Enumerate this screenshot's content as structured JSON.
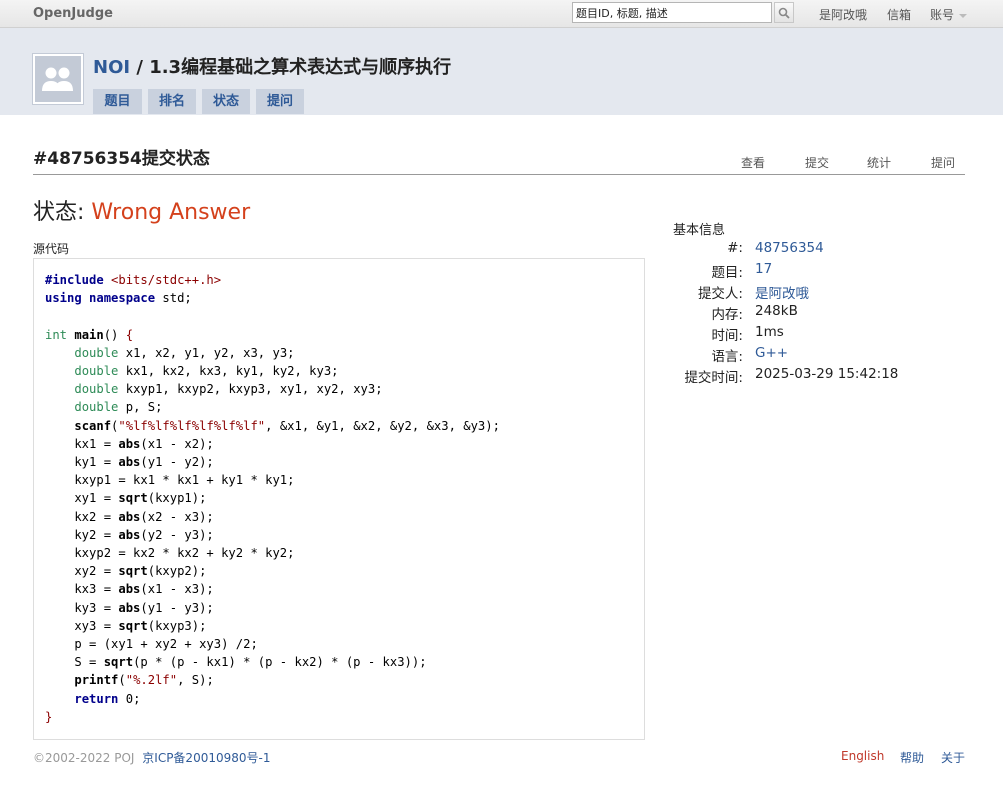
{
  "topbar": {
    "brand": "OpenJudge",
    "search_value": "题目ID, 标题, 描述",
    "user": "是阿改哦",
    "mailbox": "信箱",
    "account": "账号"
  },
  "header": {
    "group": "NOI",
    "separator": " / ",
    "course": "1.3编程基础之算术表达式与顺序执行",
    "tabs": [
      "题目",
      "排名",
      "状态",
      "提问"
    ]
  },
  "page": {
    "title": "#48756354提交状态",
    "subnav": [
      "查看",
      "提交",
      "统计",
      "提问"
    ],
    "status_label": "状态: ",
    "status_value": "Wrong Answer",
    "source_label": "源代码"
  },
  "code": [
    "#include <bits/stdc++.h>",
    "using namespace std;",
    "",
    "int main() {",
    "    double x1, x2, y1, y2, x3, y3;",
    "    double kx1, kx2, kx3, ky1, ky2, ky3;",
    "    double kxyp1, kxyp2, kxyp3, xy1, xy2, xy3;",
    "    double p, S;",
    "    scanf(\"%lf%lf%lf%lf%lf%lf\", &x1, &y1, &x2, &y2, &x3, &y3);",
    "    kx1 = abs(x1 - x2);",
    "    ky1 = abs(y1 - y2);",
    "    kxyp1 = kx1 * kx1 + ky1 * ky1;",
    "    xy1 = sqrt(kxyp1);",
    "    kx2 = abs(x2 - x3);",
    "    ky2 = abs(y2 - y3);",
    "    kxyp2 = kx2 * kx2 + ky2 * ky2;",
    "    xy2 = sqrt(kxyp2);",
    "    kx3 = abs(x1 - x3);",
    "    ky3 = abs(y1 - y3);",
    "    xy3 = sqrt(kxyp3);",
    "    p = (xy1 + xy2 + xy3) /2;",
    "    S = sqrt(p * (p - kx1) * (p - kx2) * (p - kx3));",
    "    printf(\"%.2lf\", S);",
    "    return 0;",
    "}"
  ],
  "info": {
    "title": "基本信息",
    "rows": [
      {
        "key": "#:",
        "value": "48756354",
        "link": true
      },
      {
        "key": "题目:",
        "value": "17",
        "link": true
      },
      {
        "key": "提交人:",
        "value": "是阿改哦",
        "link": true
      },
      {
        "key": "内存:",
        "value": "248kB",
        "link": false
      },
      {
        "key": "时间:",
        "value": "1ms",
        "link": false
      },
      {
        "key": "语言:",
        "value": "G++",
        "link": true
      },
      {
        "key": "提交时间:",
        "value": "2025-03-29 15:42:18",
        "link": false
      }
    ]
  },
  "footer": {
    "copyright": "©2002-2022 POJ",
    "icp": "京ICP备20010980号-1",
    "links": [
      "English",
      "帮助",
      "关于"
    ]
  },
  "colors": {
    "status_wrong": "#d4411c",
    "link": "#2f5a97",
    "header_bg": "#e4e8ef",
    "tab_bg": "#c9d1de"
  }
}
